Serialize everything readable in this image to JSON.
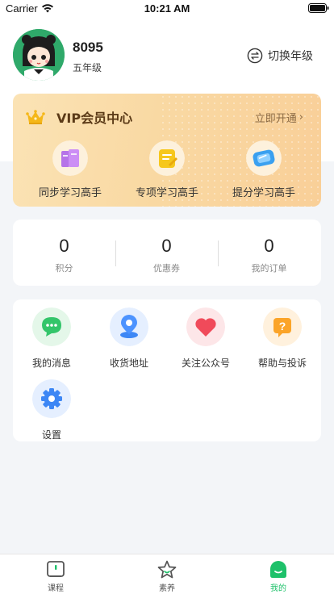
{
  "status_bar": {
    "carrier": "Carrier",
    "time": "10:21 AM"
  },
  "profile": {
    "username": "8095",
    "grade": "五年级",
    "switch_grade_label": "切换年级"
  },
  "vip": {
    "title": "VIP会员中心",
    "open_label": "立即开通",
    "items": [
      {
        "label": "同步学习高手",
        "icon": "books-icon"
      },
      {
        "label": "专项学习高手",
        "icon": "notepad-icon"
      },
      {
        "label": "提分学习高手",
        "icon": "scroll-icon"
      }
    ]
  },
  "stats": [
    {
      "value": "0",
      "label": "积分"
    },
    {
      "value": "0",
      "label": "优惠券"
    },
    {
      "value": "0",
      "label": "我的订单"
    }
  ],
  "services": [
    {
      "label": "我的消息",
      "icon": "message-icon"
    },
    {
      "label": "收货地址",
      "icon": "location-icon"
    },
    {
      "label": "关注公众号",
      "icon": "heart-icon"
    },
    {
      "label": "帮助与投诉",
      "icon": "question-icon"
    },
    {
      "label": "设置",
      "icon": "gear-icon"
    }
  ],
  "tabbar": {
    "items": [
      {
        "label": "课程",
        "icon": "course-icon",
        "active": false
      },
      {
        "label": "素养",
        "icon": "star-icon",
        "active": false
      },
      {
        "label": "我的",
        "icon": "profile-icon",
        "active": true
      }
    ]
  },
  "colors": {
    "accent_green": "#1ec16a",
    "vip_gold": "#f9d9a3",
    "vip_title": "#5b3a17"
  }
}
